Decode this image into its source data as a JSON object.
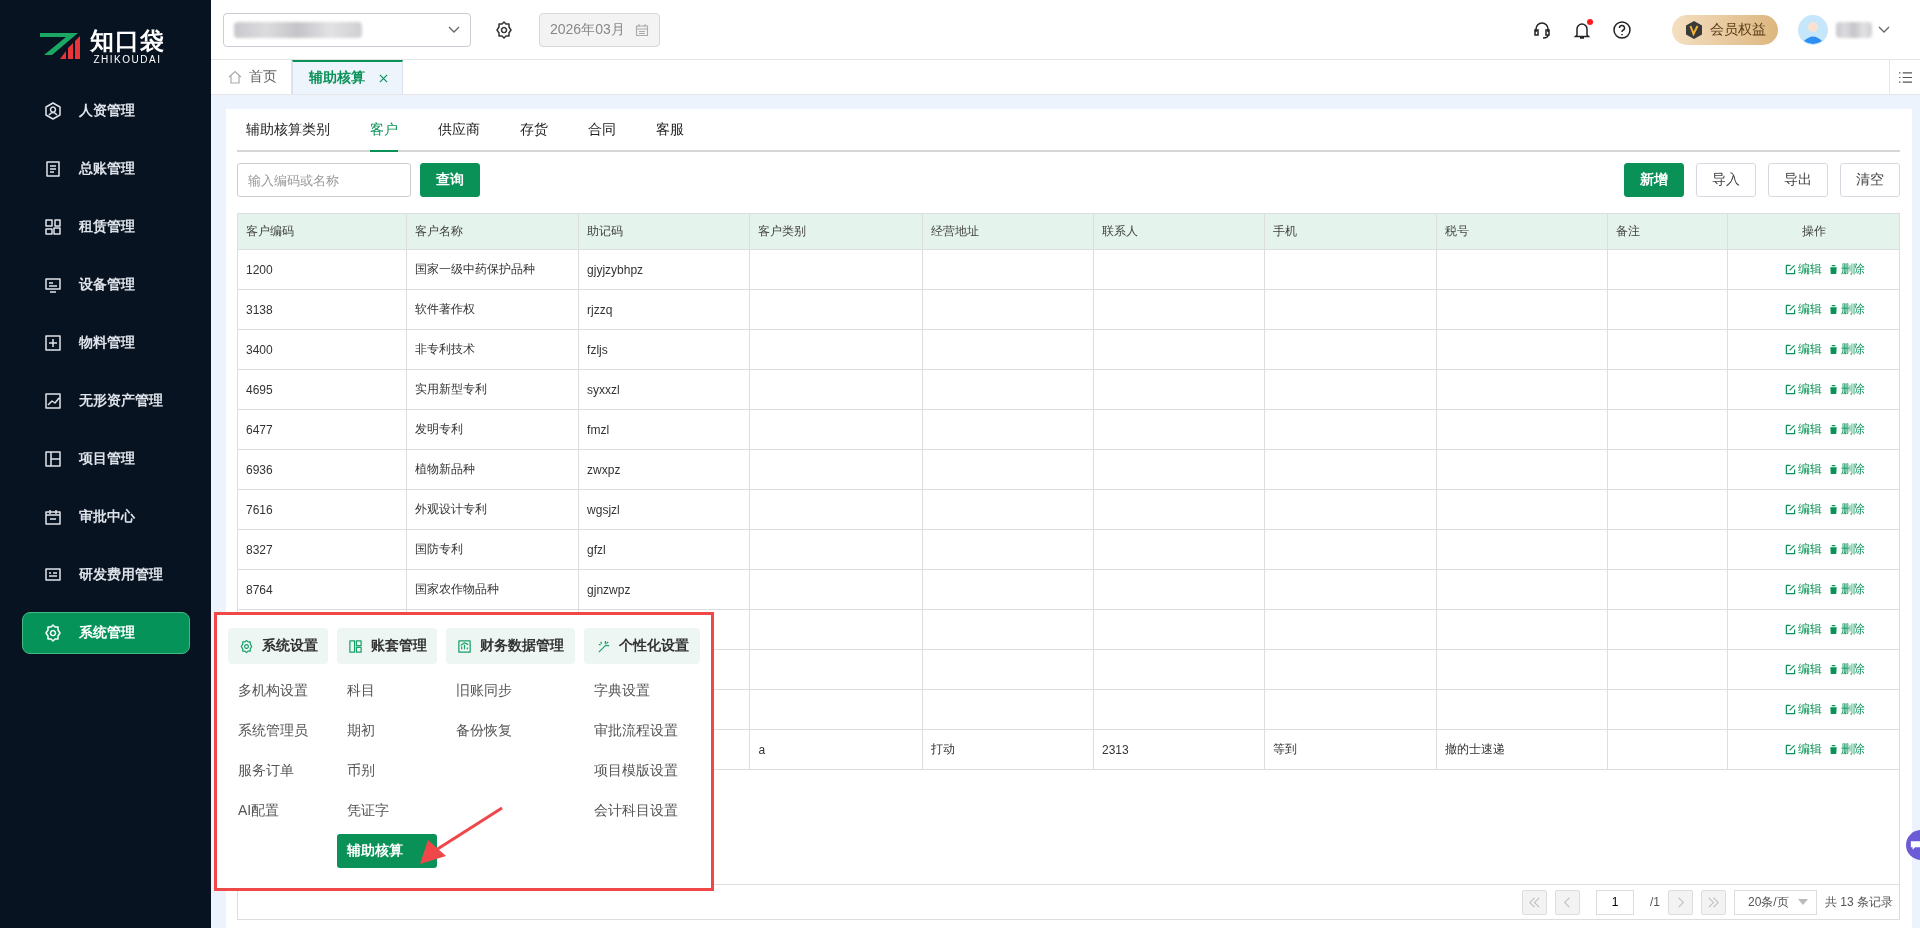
{
  "sidebar": {
    "logo": {
      "name": "知口袋",
      "subtitle": "ZHIKOUDAI"
    },
    "items": [
      {
        "label": "人资管理",
        "selected": false
      },
      {
        "label": "总账管理",
        "selected": false
      },
      {
        "label": "租赁管理",
        "selected": false
      },
      {
        "label": "设备管理",
        "selected": false
      },
      {
        "label": "物料管理",
        "selected": false
      },
      {
        "label": "无形资产管理",
        "selected": false
      },
      {
        "label": "项目管理",
        "selected": false
      },
      {
        "label": "审批中心",
        "selected": false
      },
      {
        "label": "研发费用管理",
        "selected": false
      },
      {
        "label": "系统管理",
        "selected": true
      }
    ]
  },
  "header": {
    "period": "2026年03月",
    "member_badge": "会员权益",
    "notifications_unread": true
  },
  "page_tabs": [
    {
      "label": "首页",
      "selected": false,
      "closable": false
    },
    {
      "label": "辅助核算",
      "selected": true,
      "closable": true
    }
  ],
  "sub_tabs": [
    {
      "label": "辅助核算类别",
      "selected": false
    },
    {
      "label": "客户",
      "selected": true
    },
    {
      "label": "供应商",
      "selected": false
    },
    {
      "label": "存货",
      "selected": false
    },
    {
      "label": "合同",
      "selected": false
    },
    {
      "label": "客服",
      "selected": false
    }
  ],
  "search": {
    "placeholder": "输入编码或名称"
  },
  "query_button": "查询",
  "toolbar_buttons": [
    {
      "label": "新增",
      "kind": "primary"
    },
    {
      "label": "导入",
      "kind": "default"
    },
    {
      "label": "导出",
      "kind": "default"
    },
    {
      "label": "清空",
      "kind": "default"
    }
  ],
  "table": {
    "columns": [
      "客户编码",
      "客户名称",
      "助记码",
      "客户类别",
      "经营地址",
      "联系人",
      "手机",
      "税号",
      "备注",
      "操作"
    ],
    "rows": [
      {
        "code": "1200",
        "name": "国家一级中药保护品种",
        "mnemonic": "gjyjzybhpz",
        "actions": [
          "编辑",
          "删除"
        ]
      },
      {
        "code": "3138",
        "name": "软件著作权",
        "mnemonic": "rjzzq",
        "actions": [
          "编辑",
          "删除"
        ]
      },
      {
        "code": "3400",
        "name": "非专利技术",
        "mnemonic": "fzljs",
        "actions": [
          "编辑",
          "删除"
        ]
      },
      {
        "code": "4695",
        "name": "实用新型专利",
        "mnemonic": "syxxzl",
        "actions": [
          "编辑",
          "删除"
        ]
      },
      {
        "code": "6477",
        "name": "发明专利",
        "mnemonic": "fmzl",
        "actions": [
          "编辑",
          "删除"
        ]
      },
      {
        "code": "6936",
        "name": "植物新品种",
        "mnemonic": "zwxpz",
        "actions": [
          "编辑",
          "删除"
        ]
      },
      {
        "code": "7616",
        "name": "外观设计专利",
        "mnemonic": "wgsjzl",
        "actions": [
          "编辑",
          "删除"
        ]
      },
      {
        "code": "8327",
        "name": "国防专利",
        "mnemonic": "gfzl",
        "actions": [
          "编辑",
          "删除"
        ]
      },
      {
        "code": "8764",
        "name": "国家农作物品种",
        "mnemonic": "gjnzwpz",
        "actions": [
          "编辑",
          "删除"
        ]
      },
      {
        "actions": [
          "编辑",
          "删除"
        ]
      },
      {
        "actions": [
          "编辑",
          "删除"
        ]
      },
      {
        "actions": [
          "编辑",
          "删除"
        ]
      },
      {
        "category": "a",
        "address": "打动",
        "contact": "2313",
        "phone": "等到",
        "tax_no": "撤的士速递",
        "actions": [
          "编辑",
          "删除"
        ]
      }
    ]
  },
  "pagination": {
    "nav_buttons": [
      {
        "kind": "first",
        "disabled": true
      },
      {
        "kind": "prev",
        "disabled": true
      },
      {
        "kind": "next",
        "disabled": true
      },
      {
        "kind": "last",
        "disabled": true
      }
    ],
    "page": "1",
    "total_pages": "/1",
    "page_size": "20条/页",
    "total": "共 13 条记录"
  },
  "menu": {
    "groups": [
      {
        "title": "系统设置",
        "items": [
          {
            "label": "多机构设置",
            "selected": false
          },
          {
            "label": "系统管理员",
            "selected": false
          },
          {
            "label": "服务订单",
            "selected": false
          },
          {
            "label": "AI配置",
            "selected": false
          }
        ]
      },
      {
        "title": "账套管理",
        "items": [
          {
            "label": "科目",
            "selected": false
          },
          {
            "label": "期初",
            "selected": false
          },
          {
            "label": "币别",
            "selected": false
          },
          {
            "label": "凭证字",
            "selected": false
          },
          {
            "label": "辅助核算",
            "selected": true
          }
        ]
      },
      {
        "title": "财务数据管理",
        "items": [
          {
            "label": "旧账同步",
            "selected": false
          },
          {
            "label": "备份恢复",
            "selected": false
          }
        ]
      },
      {
        "title": "个性化设置",
        "items": [
          {
            "label": "字典设置",
            "selected": false
          },
          {
            "label": "审批流程设置",
            "selected": false
          },
          {
            "label": "项目模版设置",
            "selected": false
          },
          {
            "label": "会计科目设置",
            "selected": false
          }
        ]
      }
    ]
  }
}
